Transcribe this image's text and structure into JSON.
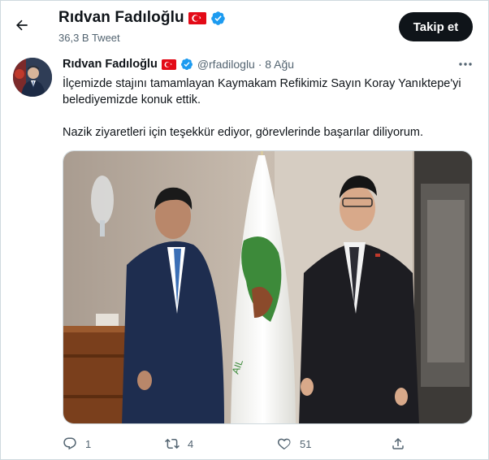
{
  "header": {
    "display_name": "Rıdvan Fadıloğlu",
    "tweet_count": "36,3 B Tweet",
    "follow_label": "Takip et"
  },
  "tweet": {
    "author_name": "Rıdvan Fadıloğlu",
    "handle_date": "@rfadiloglu · 8 Ağu",
    "text_1": "İlçemizde stajını tamamlayan Kaymakam Refikimiz Sayın Koray Yanıktepe'yi belediyemizde konuk ettik.",
    "text_2": "Nazik ziyaretleri için teşekkür ediyor, görevlerinde başarılar diliyorum.",
    "replies": "1",
    "retweets": "4",
    "likes": "51"
  },
  "colors": {
    "accent": "#1d9bf0",
    "text": "#0f1419",
    "muted": "#536471",
    "flag_red": "#e30a17",
    "button_bg": "#0f1419"
  },
  "icons": {
    "back": "arrow-left-icon",
    "verified": "verified-badge-icon",
    "flag": "turkey-flag-icon",
    "more": "more-dots-icon",
    "reply": "reply-icon",
    "retweet": "retweet-icon",
    "like": "heart-icon",
    "share": "share-icon"
  }
}
